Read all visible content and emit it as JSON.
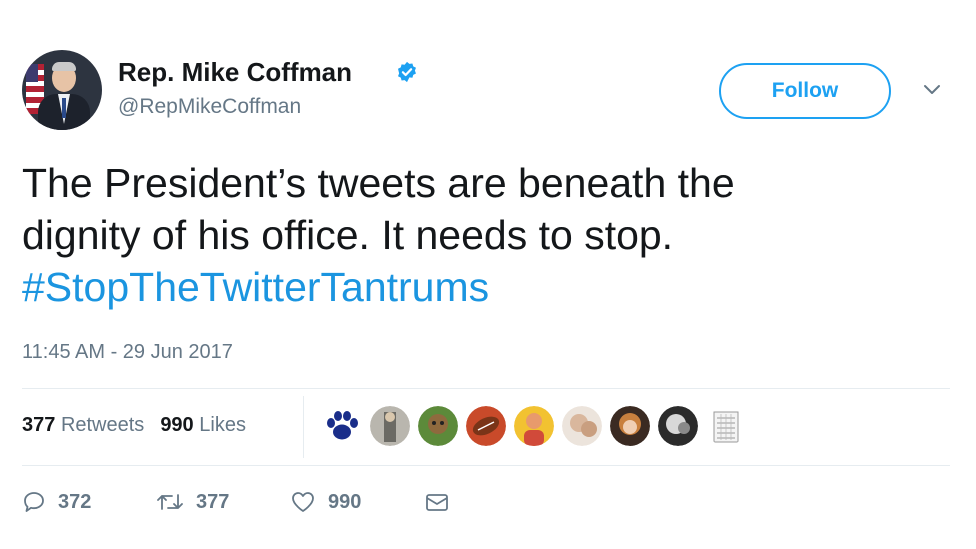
{
  "account": {
    "name": "Rep. Mike Coffman",
    "handle": "@RepMikeCoffman",
    "verified": true,
    "verified_icon": "verified-badge-icon"
  },
  "follow_button": {
    "label": "Follow"
  },
  "menu": {
    "icon": "chevron-down-icon"
  },
  "tweet": {
    "line1": "The President’s tweets are beneath the",
    "line2": "dignity of his office. It needs to stop.",
    "hashtag": "#StopTheTwitterTantrums"
  },
  "timestamp": "11:45 AM - 29 Jun 2017",
  "stats": {
    "retweets_count": "377",
    "retweets_label": "Retweets",
    "likes_count": "990",
    "likes_label": "Likes"
  },
  "actions": {
    "reply_count": "372",
    "retweet_count": "377",
    "like_count": "990"
  },
  "colors": {
    "accent": "#1da1f2",
    "hashtag": "#1b95e0",
    "secondary_text": "#657786",
    "primary_text": "#14171a"
  }
}
